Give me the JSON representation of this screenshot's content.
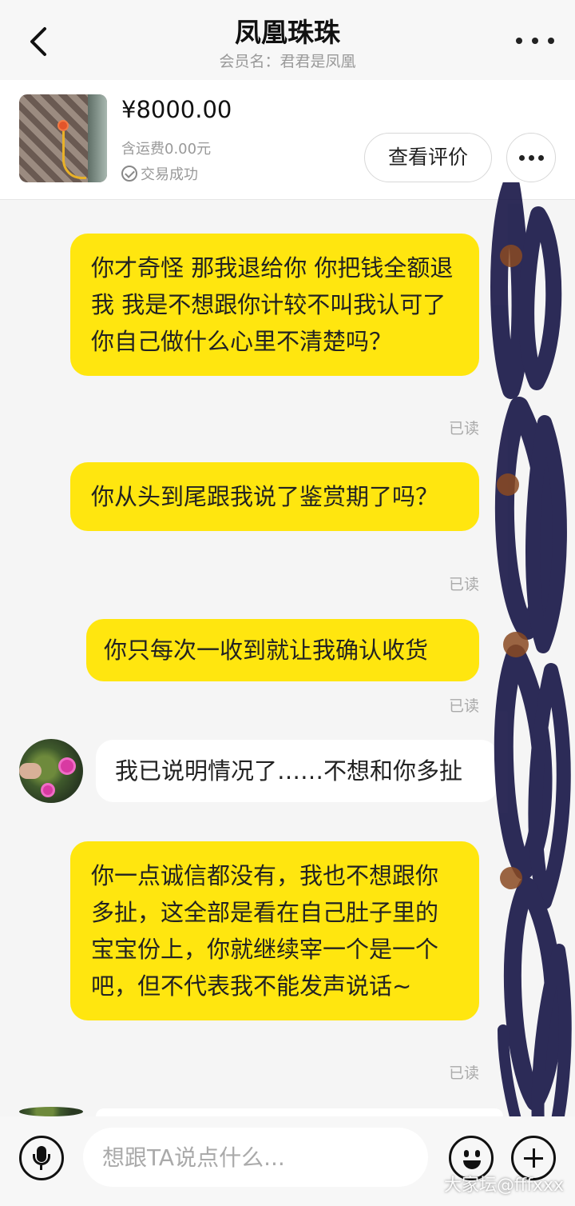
{
  "header": {
    "title": "凤凰珠珠",
    "subtitle": "会员名：君君是凤凰"
  },
  "product": {
    "price": "¥8000.00",
    "shipping": "含运费0.00元",
    "status": "交易成功",
    "review_button": "查看评价"
  },
  "messages": [
    {
      "side": "mine",
      "text": "你才奇怪 那我退给你 你把钱全额退我 我是不想跟你计较不叫我认可了  你自己做什么心里不清楚吗？",
      "read": "已读"
    },
    {
      "side": "mine",
      "text": "你从头到尾跟我说了鉴赏期了吗？",
      "read": "已读"
    },
    {
      "side": "mine",
      "text": "你只每次一收到就让我确认收货",
      "read": "已读"
    },
    {
      "side": "theirs",
      "text": "我已说明情况了……不想和你多扯"
    },
    {
      "side": "mine",
      "text": "你一点诚信都没有，我也不想跟你多扯，这全部是看在自己肚子里的宝宝份上，你就继续宰一个是一个吧，但不代表我不能发声说话~",
      "read": "已读"
    }
  ],
  "composer": {
    "placeholder": "想跟TA说点什么..."
  },
  "watermark": "大家坛@fffxxx",
  "colors": {
    "my_bubble": "#ffe60f",
    "their_bubble": "#ffffff",
    "background": "#f5f5f5"
  }
}
